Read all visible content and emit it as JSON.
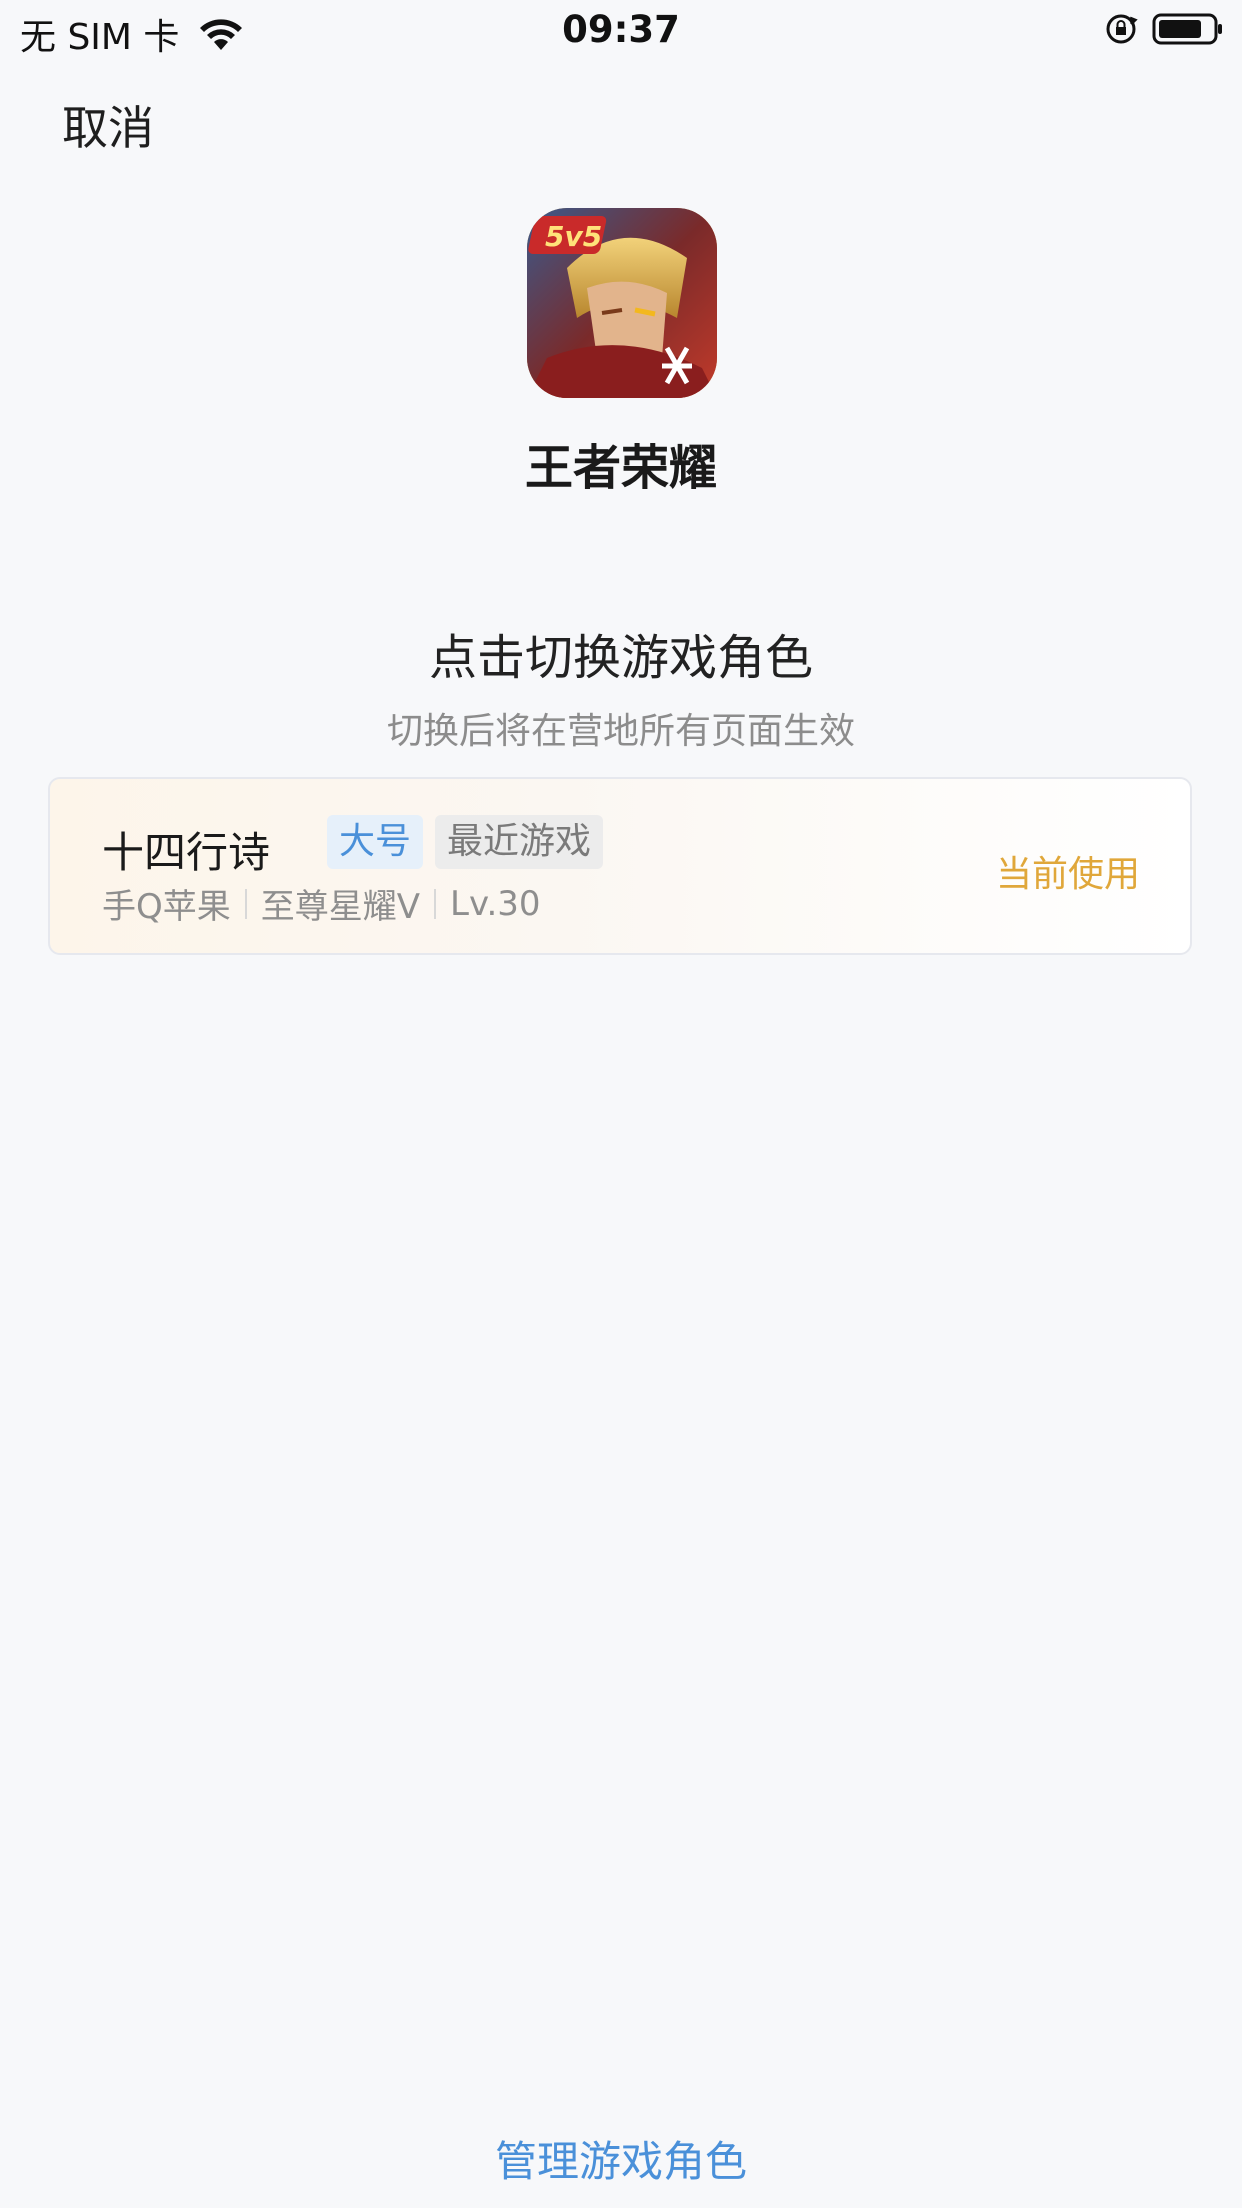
{
  "status_bar": {
    "carrier": "无 SIM 卡",
    "time": "09:37"
  },
  "header": {
    "cancel_label": "取消"
  },
  "app": {
    "name": "王者荣耀",
    "icon_badge": "5v5"
  },
  "section": {
    "title": "点击切换游戏角色",
    "subtitle": "切换后将在营地所有页面生效"
  },
  "role": {
    "name": "十四行诗",
    "tags": [
      "大号",
      "最近游戏"
    ],
    "platform": "手Q苹果",
    "rank": "至尊星耀V",
    "level": "Lv.30",
    "status": "当前使用"
  },
  "footer": {
    "manage_label": "管理游戏角色"
  },
  "colors": {
    "accent_blue": "#4a90d9",
    "current_gold": "#e0a73a",
    "background": "#f7f8fa"
  }
}
